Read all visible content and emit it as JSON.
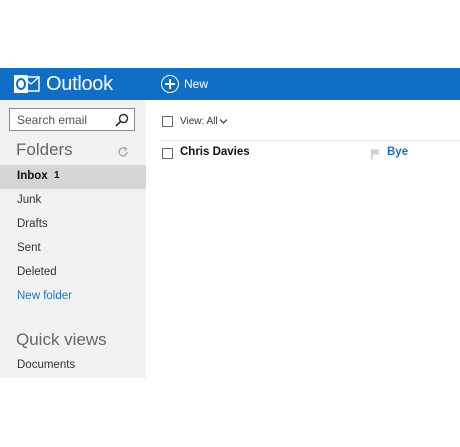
{
  "header": {
    "app_name": "Outlook",
    "new_label": "New",
    "brand_color": "#0f6fc6"
  },
  "sidebar": {
    "search_placeholder": "Search email",
    "folders_title": "Folders",
    "items": [
      {
        "label": "Inbox",
        "count": "1",
        "selected": true
      },
      {
        "label": "Junk"
      },
      {
        "label": "Drafts"
      },
      {
        "label": "Sent"
      },
      {
        "label": "Deleted"
      },
      {
        "label": "New folder"
      }
    ],
    "quick_views_title": "Quick views",
    "quick_items": [
      {
        "label": "Documents"
      }
    ]
  },
  "list": {
    "view_label": "View: All",
    "messages": [
      {
        "sender": "Chris Davies",
        "subject": "Bye",
        "flag_icon": "flag-icon"
      }
    ]
  },
  "icons": {
    "logo": "outlook-logo-icon",
    "search": "search-icon",
    "refresh": "refresh-icon",
    "new": "plus-circle-icon",
    "view_dropdown": "chevron-down-icon"
  }
}
